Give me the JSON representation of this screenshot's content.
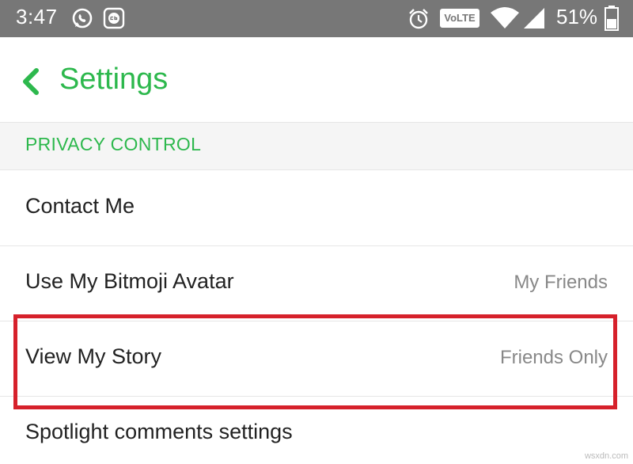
{
  "status_bar": {
    "time": "3:47",
    "network_badge": "VoLTE",
    "battery": "51%"
  },
  "header": {
    "title": "Settings",
    "back_icon": "chevron-left-icon"
  },
  "section": {
    "title": "PRIVACY CONTROL"
  },
  "rows": [
    {
      "label": "Contact Me",
      "value": ""
    },
    {
      "label": "Use My Bitmoji Avatar",
      "value": "My Friends"
    },
    {
      "label": "View My Story",
      "value": "Friends Only"
    },
    {
      "label": "Spotlight comments settings",
      "value": ""
    }
  ],
  "watermark": "wsxdn.com",
  "colors": {
    "accent": "#2db84d",
    "highlight": "#d6212b",
    "status_bar": "#777777"
  }
}
